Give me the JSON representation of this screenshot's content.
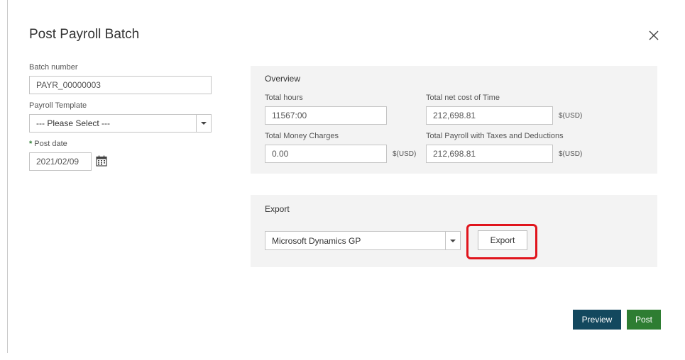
{
  "dialog": {
    "title": "Post Payroll Batch"
  },
  "left_form": {
    "batch_number_label": "Batch number",
    "batch_number_value": "PAYR_00000003",
    "template_label": "Payroll Template",
    "template_value": "--- Please Select ---",
    "post_date_required_marker": "*",
    "post_date_label": "Post date",
    "post_date_value": "2021/02/09"
  },
  "overview": {
    "title": "Overview",
    "total_hours_label": "Total hours",
    "total_hours_value": "11567:00",
    "net_cost_label": "Total net cost of Time",
    "net_cost_value": "212,698.81",
    "net_cost_unit": "$(USD)",
    "money_charges_label": "Total Money Charges",
    "money_charges_value": "0.00",
    "money_charges_unit": "$(USD)",
    "payroll_taxes_label": "Total Payroll with Taxes and Deductions",
    "payroll_taxes_value": "212,698.81",
    "payroll_taxes_unit": "$(USD)"
  },
  "export": {
    "title": "Export",
    "format_value": "Microsoft Dynamics GP",
    "button_label": "Export",
    "highlight_color": "#e0141c"
  },
  "footer": {
    "preview_label": "Preview",
    "post_label": "Post",
    "preview_color": "#13485e",
    "post_color": "#2e7d32"
  }
}
